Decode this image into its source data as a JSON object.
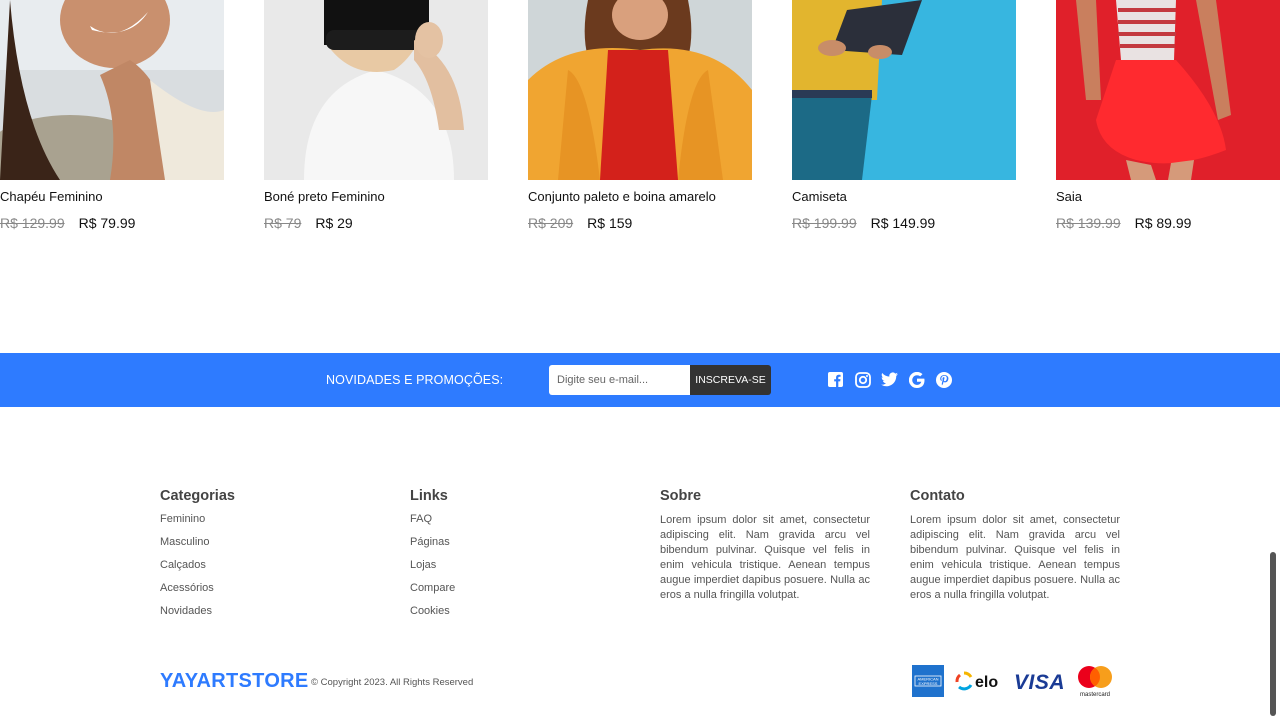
{
  "products": [
    {
      "name": "Chapéu Feminino",
      "old_price": "R$ 129.99",
      "price": "R$ 79.99"
    },
    {
      "name": "Boné preto Feminino",
      "old_price": "R$ 79",
      "price": "R$ 29"
    },
    {
      "name": "Conjunto paleto e boina amarelo",
      "old_price": "R$ 209",
      "price": "R$ 159"
    },
    {
      "name": "Camiseta",
      "old_price": "R$ 199.99",
      "price": "R$ 149.99"
    },
    {
      "name": "Saia",
      "old_price": "R$ 139.99",
      "price": "R$ 89.99"
    }
  ],
  "newsletter": {
    "label": "NOVIDADES E PROMOÇÕES:",
    "placeholder": "Digite seu e-mail...",
    "button": "INSCREVA-SE",
    "social_icons": [
      "facebook-icon",
      "instagram-icon",
      "twitter-icon",
      "google-icon",
      "pinterest-icon"
    ]
  },
  "footer": {
    "categories": {
      "title": "Categorias",
      "items": [
        "Feminino",
        "Masculino",
        "Calçados",
        "Acessórios",
        "Novidades"
      ]
    },
    "links": {
      "title": "Links",
      "items": [
        "FAQ",
        "Páginas",
        "Lojas",
        "Compare",
        "Cookies"
      ]
    },
    "about": {
      "title": "Sobre",
      "text": "Lorem ipsum dolor sit amet, consectetur adipiscing elit. Nam gravida arcu vel bibendum pulvinar. Quisque vel felis in enim vehicula tristique. Aenean tempus augue imperdiet dapibus posuere. Nulla ac eros a nulla fringilla volutpat."
    },
    "contact": {
      "title": "Contato",
      "text": "Lorem ipsum dolor sit amet, consectetur adipiscing elit. Nam gravida arcu vel bibendum pulvinar. Quisque vel felis in enim vehicula tristique. Aenean tempus augue imperdiet dapibus posuere. Nulla ac eros a nulla fringilla volutpat."
    },
    "brand": "YAYARTSTORE",
    "copyright": "© Copyright 2023. All Rights Reserved",
    "payments": {
      "amex": "AMERICAN EXPRESS",
      "elo": "elo",
      "visa": "VISA",
      "mastercard": "mastercard"
    }
  },
  "colors": {
    "accent": "#2e7bff",
    "dark": "#333333"
  }
}
